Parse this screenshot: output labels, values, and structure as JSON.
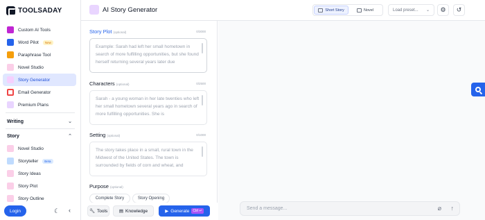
{
  "brand": {
    "name": "TOOLSADAY"
  },
  "sidebar": {
    "items": [
      {
        "label": "Custom AI Tools",
        "icon": "layers-icon",
        "color": "#c026d3"
      },
      {
        "label": "Word Pilot",
        "icon": "word-icon",
        "color": "#2563eb",
        "badge": "New"
      },
      {
        "label": "Paraphrase Tool",
        "icon": "paraphrase-icon",
        "color": "#f59e0b"
      },
      {
        "label": "Novel Studio",
        "icon": "novel-icon",
        "color": "#ec4899"
      },
      {
        "label": "Story Generator",
        "icon": "story-icon",
        "color": "#d946ef"
      },
      {
        "label": "Email Generator",
        "icon": "gmail-icon",
        "color": "#ef4444"
      },
      {
        "label": "Premium Plans",
        "icon": "premium-icon",
        "color": "#a855f7"
      }
    ],
    "writing_section": "Writing",
    "story_section": "Story",
    "story_items": [
      {
        "label": "Novel Studio",
        "icon": "novel-icon",
        "color": "#ec4899"
      },
      {
        "label": "Storyteller",
        "icon": "storyteller-icon",
        "color": "#3b82f6",
        "badge": "Beta"
      },
      {
        "label": "Story Ideas",
        "icon": "ideas-icon",
        "color": "#f472b6"
      },
      {
        "label": "Story Plot",
        "icon": "plot-icon",
        "color": "#f472b6"
      },
      {
        "label": "Story Outline",
        "icon": "outline-icon",
        "color": "#f472b6"
      }
    ],
    "login": "Login"
  },
  "header": {
    "title": "AI Story Generator",
    "short_story": "Short Story",
    "novel": "Novel",
    "preset_placeholder": "Load preset..."
  },
  "form": {
    "plot": {
      "label": "Story Plot",
      "optional": "(optional)",
      "counter": "0/3000",
      "placeholder": "Example: Sarah had left her small hometown in search of more fulfilling opportunities, but she found herself returning several years later due"
    },
    "characters": {
      "label": "Characters",
      "optional": "(optional)",
      "counter": "0/2500",
      "placeholder": "Sarah - a young woman in her late twenties who left her small hometown several years ago in search of more fulfilling opportunities. She is"
    },
    "setting": {
      "label": "Setting",
      "optional": "(optional)",
      "counter": "0/1000",
      "placeholder": "The story takes place in a small, rural town in the Midwest of the United States. The town is surrounded by fields of corn and wheat, and"
    },
    "purpose": {
      "label": "Purpose",
      "optional": "(optional)",
      "options": [
        "Complete Story",
        "Story Opening"
      ]
    }
  },
  "toolbar": {
    "tools": "Tools",
    "knowledge": "Knowledge",
    "generate": "Generate",
    "shortcut": "Ctrl ↵"
  },
  "chat": {
    "placeholder": "Send a message..."
  },
  "colors": {
    "accent": "#2563eb",
    "active_bg": "#e0e7ff"
  }
}
